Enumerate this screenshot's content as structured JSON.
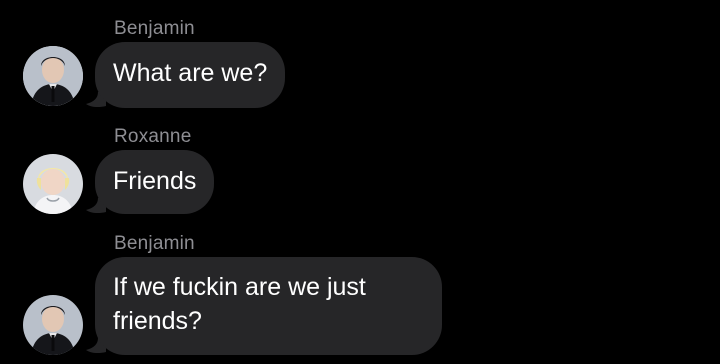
{
  "conversation": {
    "messages": [
      {
        "sender": "Benjamin",
        "text": "What are we?",
        "avatar_icon": "profile-photo-benjamin"
      },
      {
        "sender": "Roxanne",
        "text": "Friends",
        "avatar_icon": "profile-photo-roxanne"
      },
      {
        "sender": "Benjamin",
        "text": "If we fuckin are we just friends?",
        "avatar_icon": "profile-photo-benjamin"
      }
    ]
  },
  "colors": {
    "background": "#000000",
    "bubble": "#262628",
    "sender_name": "#8e8e93",
    "message_text": "#ffffff"
  }
}
